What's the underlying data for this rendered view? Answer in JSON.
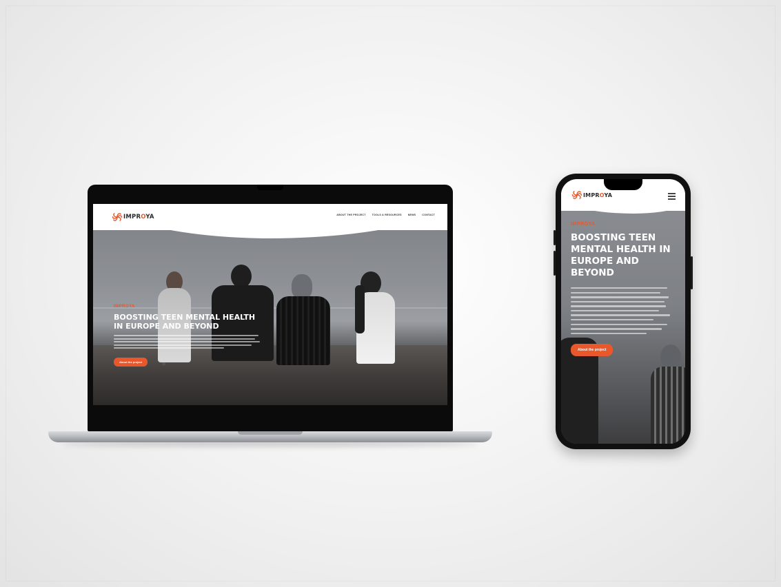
{
  "brand": {
    "logo_prefix": "IMPR",
    "logo_accent": "O",
    "logo_suffix": "YA",
    "accent_color": "#e8582c",
    "logo_icon": "swirl-logo-icon"
  },
  "laptop": {
    "nav": [
      "ABOUT THE PROJECT",
      "TOOLS & RESOURCES",
      "NEWS",
      "CONTACT"
    ],
    "hero": {
      "kicker": "IMPROYA",
      "title": "BOOSTING TEEN MENTAL HEALTH IN EUROPE AND BEYOND",
      "cta": "About the project"
    }
  },
  "phone": {
    "menu_icon": "hamburger-icon",
    "hero": {
      "kicker": "IMPROYA",
      "title": "BOOSTING TEEN MENTAL HEALTH IN EUROPE AND BEYOND",
      "cta": "About the project"
    }
  }
}
